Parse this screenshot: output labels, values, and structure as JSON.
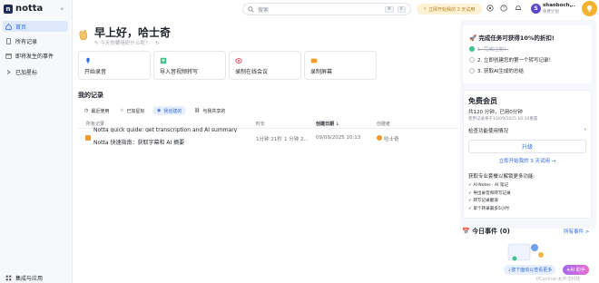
{
  "app": {
    "logo_letter": "n",
    "name": "notta"
  },
  "sidebar": {
    "items": [
      {
        "label": "首页",
        "active": true
      },
      {
        "label": "所有记录"
      },
      {
        "label": "即将发生的事件"
      },
      {
        "label": "已加星标"
      }
    ],
    "footer_label": "集成与应用"
  },
  "topbar": {
    "search_placeholder": "搜索",
    "kbd_1": "⌘",
    "kbd_2": "K",
    "trial_label": "立即开始我的 3 天试用",
    "user_initial": "S",
    "user_name": "shaoboch...",
    "user_plan": "免费计划"
  },
  "home": {
    "greeting": "早上好，哈士奇",
    "subtitle": "今天你要组织什么呢？"
  },
  "quick_actions": [
    {
      "label": "开始录音"
    },
    {
      "label": "导入音视频转写"
    },
    {
      "label": "录制在线会议"
    },
    {
      "label": "录制屏幕"
    }
  ],
  "records": {
    "title": "我的记录",
    "filters": [
      "最近使用",
      "已加星标",
      "我创建的",
      "与我共享的"
    ],
    "active_filter": 2,
    "columns": [
      "所有记录",
      "时长",
      "创建日期",
      "创建者"
    ],
    "sort_indicator": "↓",
    "rows": [
      {
        "name": "Notta quick guide: get transcription and AI summary"
      },
      {
        "name": "Notta 快速指南：获取字幕和 AI 摘要",
        "duration": "1分钟 21秒",
        "duration2": "1 分钟 2...",
        "date": "09/09/2025 10:13",
        "creator": "哈士奇"
      }
    ]
  },
  "tasks": {
    "title": "🚀 完成任务可获得10%的折扣!",
    "items": [
      {
        "label": "1. 完成注册！",
        "done": true
      },
      {
        "label": "2. 立即创建您的第一个转写记录！",
        "done": false
      },
      {
        "label": "3. 获取AI生成的总结",
        "done": false
      }
    ]
  },
  "membership": {
    "title": "免费会员",
    "quota": "共120 分钟，已用0分钟",
    "reset": "使用记录将于10/09/2025 10:10重置",
    "compare_label": "检查功能使用情况",
    "upgrade_label": "升级",
    "trial_link": "立即开始我的 3 天试用 →",
    "unlock_title": "获取专业套餐以解锁更多功能:",
    "features": [
      "AI Notes · AI 笔记",
      "导出录音和转写记录",
      "转写记录翻译",
      "单个转录最多5小时"
    ]
  },
  "events": {
    "title": "📅 今日事件 (0)",
    "see_all": "所有事件 >"
  },
  "bottom": {
    "sync_chip": "按下面动以查看更多",
    "ai_chip": "AI 助手",
    "watermark": "PConline·太平洋科技"
  },
  "colors": {
    "accent": "#2f6be0",
    "active_bg": "#dde8fb",
    "trial_bg": "#fdf2d6",
    "trial_text": "#b7821a",
    "success": "#3ec38c"
  }
}
